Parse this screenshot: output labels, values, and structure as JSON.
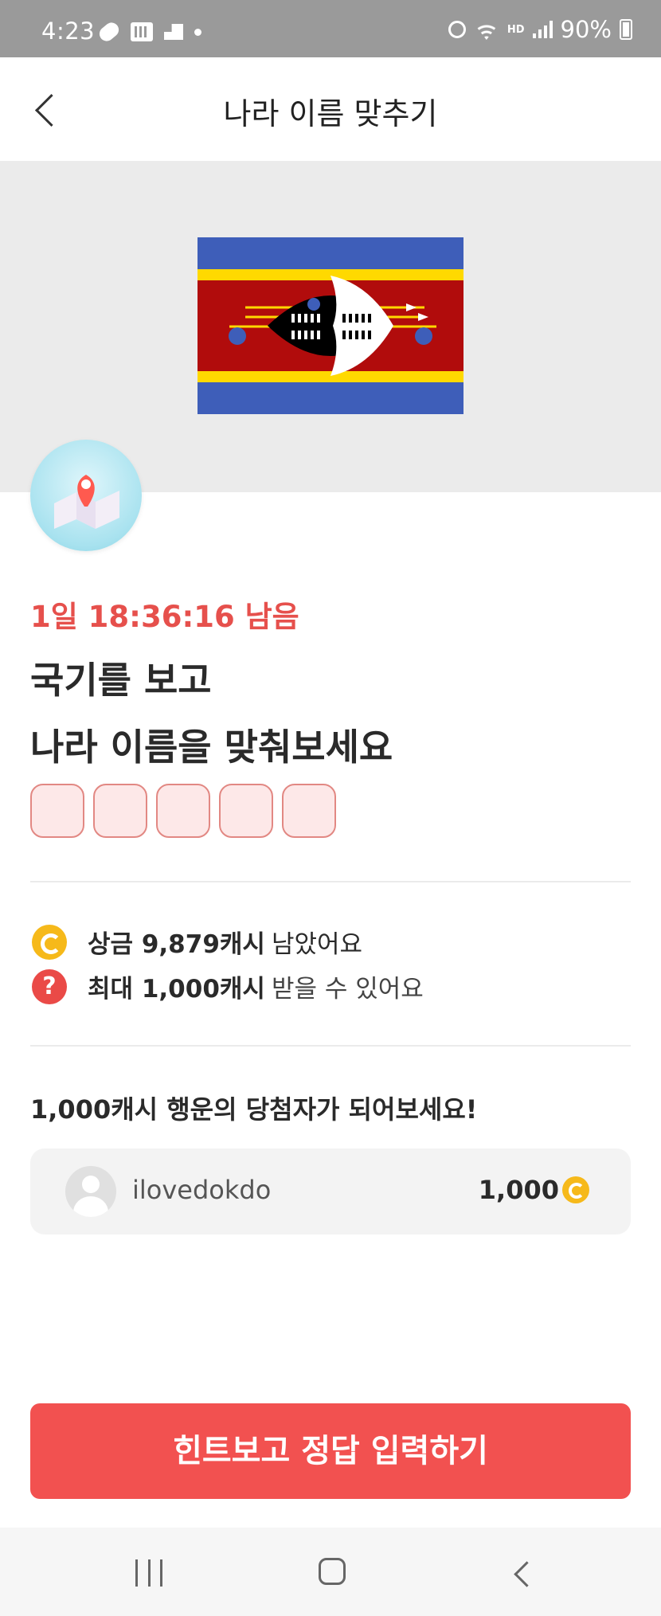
{
  "status_bar": {
    "time": "4:23",
    "battery": "90%",
    "hd_label": "HD"
  },
  "header": {
    "title": "나라 이름 맞추기"
  },
  "quiz": {
    "timer": "1일 18:36:16 남음",
    "headline_line1": "국기를 보고",
    "headline_line2": "나라 이름을 맞춰보세요",
    "answer_length": 5
  },
  "rewards": {
    "prize_strong": "상금 9,879캐시",
    "prize_rest": "남았어요",
    "max_strong": "최대 1,000캐시",
    "max_rest": "받을 수 있어요",
    "question_glyph": "?"
  },
  "winners": {
    "title": "1,000캐시 행운의 당첨자가 되어보세요!",
    "items": [
      {
        "name": "ilovedokdo",
        "amount": "1,000"
      }
    ]
  },
  "cta": {
    "label": "힌트보고 정답 입력하기"
  },
  "colors": {
    "accent": "#f25150",
    "timer": "#e6504c",
    "coin": "#f6b91a",
    "flag_blue": "#3e5eb9",
    "flag_yellow": "#ffd900",
    "flag_red": "#b10c0c"
  }
}
